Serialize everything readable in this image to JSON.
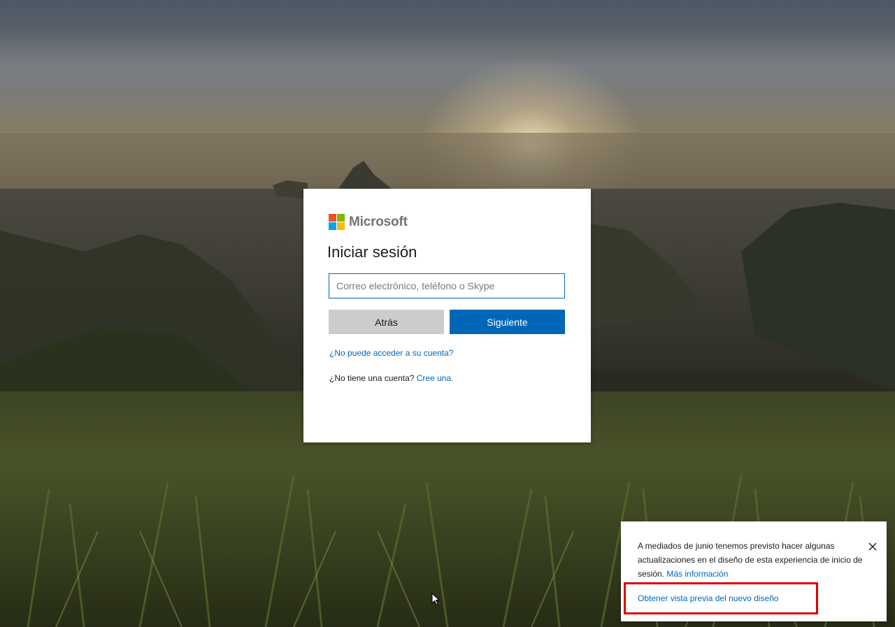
{
  "brand": {
    "name": "Microsoft",
    "logo_colors": [
      "#f25022",
      "#7fba00",
      "#00a4ef",
      "#ffb900"
    ]
  },
  "signin": {
    "title": "Iniciar sesión",
    "email_placeholder": "Correo electrónico, teléfono o Skype",
    "email_value": "",
    "back_label": "Atrás",
    "next_label": "Siguiente",
    "cant_access_link": "¿No puede acceder a su cuenta?",
    "no_account_text": "¿No tiene una cuenta?",
    "create_link": "Cree una."
  },
  "notice": {
    "message": "A mediados de junio tenemos previsto hacer algunas actualizaciones en el diseño de esta experiencia de inicio de sesión.",
    "more_info_link": "Más información",
    "preview_link": "Obtener vista previa del nuevo diseño",
    "close_icon": "close-icon",
    "highlight_color": "#e00000"
  },
  "colors": {
    "accent": "#0067b8",
    "back_button": "#cccccc"
  }
}
